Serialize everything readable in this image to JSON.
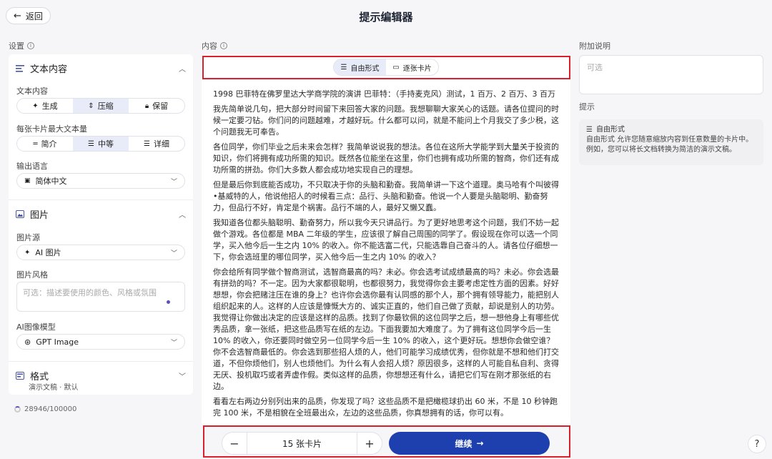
{
  "header": {
    "back_label": "返回",
    "title": "提示编辑器"
  },
  "settings": {
    "section_label": "设置",
    "text_group": {
      "title": "文本内容",
      "text_content_label": "文本内容",
      "text_content_options": [
        "生成",
        "压缩",
        "保留"
      ],
      "text_content_selected": "压缩",
      "max_text_label": "每张卡片最大文本量",
      "max_text_options": [
        "简介",
        "中等",
        "详细"
      ],
      "max_text_selected": "中等",
      "language_label": "输出语言",
      "language_value": "简体中文"
    },
    "image_group": {
      "title": "图片",
      "source_label": "图片源",
      "source_value": "AI 图片",
      "style_label": "图片风格",
      "style_placeholder": "可选：描述要使用的颜色、风格或氛围",
      "model_label": "AI图像模型",
      "model_value": "GPT Image"
    },
    "format_group": {
      "title": "格式",
      "subtitle": "演示文稿 · 默认"
    },
    "counter": "28946/100000"
  },
  "content": {
    "section_label": "内容",
    "modes": [
      "自由形式",
      "逐张卡片"
    ],
    "mode_selected": "自由形式",
    "paragraphs": [
      "1998 巴菲特在佛罗里达大学商学院的演讲 巴菲特：（手持麦克风）测试，1 百万、2 百万、3 百万",
      "我先简单说几句，把大部分时间留下来回答大家的问题。我想聊聊大家关心的话题。请各位提问的时候一定要刁钻。你们问的问题越难，才越好玩。什么都可以问，就是不能问上个月我交了多少税，这个问题我无可奉告。",
      "各位同学，你们毕业之后未来会怎样？我简单说说我的想法。各位在这所大学能学到大量关于投资的知识，你们将拥有成功所需的知识。既然各位能坐在这里，你们也拥有成功所需的智商，你们还有成功所需的拼劲。你们大多数人都会成功地实现自己的理想。",
      "但是最后你到底能否成功，不只取决于你的头脑和勤奋。我简单讲一下这个道理。奥马哈有个叫彼得•基威特的人，他说他招人的时候看三点：品行、头脑和勤奋。他说一个人要是头脑聪明、勤奋努力，但品行不好，肯定是个祸害。品行不端的人，最好又懒又蠢。",
      "我知道各位都头脑聪明、勤奋努力，所以我今天只讲品行。为了更好地思考这个问题，我们不妨一起做个游戏。各位都是 MBA 二年级的学生，应该很了解自己周围的同学了。假设现在你可以选一个同学，买入他今后一生之内 10% 的收入。你不能选富二代，只能选靠自己奋斗的人。请各位仔细想一下，你会选班里的哪位同学，买入他今后一生之内 10% 的收入？",
      "你会给所有同学做个智商测试，选智商最高的吗？未必。你会选考试成绩最高的吗？未必。你会选最有拼劲的吗？不一定。因为大家都很聪明，也都很努力，我觉得你会主要考虑定性方面的因素。好好想想，你会把赌注压在谁的身上？也许你会选你最有认同感的那个人，那个拥有领导能力，能把别人组织起来的人。这样的人应该是慷慨大方的、诚实正直的，他们自己做了贡献，却说是别人的功劳。我觉得让你做出决定的应该是这样的品质。找到了你最钦佩的这位同学之后，想一想他身上有哪些优秀品质，拿一张纸，把这些品质写在纸的左边。下面我要加大难度了。为了拥有这位同学今后一生 10% 的收入，你还要同时做空另一位同学今后一生 10% 的收入，这个更好玩。想想你会做空谁？你不会选智商最低的。你会选到那些招人烦的人，他们可能学习成绩优秀，但你就是不想和他们打交道，不但你烦他们，别人也烦他们。为什么有人会招人烦？原因很多，这样的人可能自私自利、贪得无厌、投机取巧或者弄虚作假。类似这样的品质，你想想还有什么，请把它们写在刚才那张纸的右边。",
      "看看左右两边分别列出来的品质，你发现了吗？这些品质不是把橄榄球扔出 60 米，不是 10 秒钟跑完 100 米，不是相貌在全班最出众，左边的这些品质，你真想拥有的话，你可以有。"
    ]
  },
  "footer": {
    "card_count": "15 张卡片",
    "minus": "−",
    "plus": "+",
    "continue_label": "继续",
    "continue_arrow": "→",
    "help": "?"
  },
  "notes": {
    "section_label": "附加说明",
    "placeholder": "可选",
    "tip_label": "提示",
    "tip_title": "自由形式",
    "tip_body": "自由形式 允许您随意缩放内容到任意数量的卡片中。例如，您可以将长文档转换为简洁的演示文稿。"
  },
  "colors": {
    "accent": "#1e3fae",
    "highlight_box": "#d9202c",
    "selected_bg": "#e8ecf9"
  },
  "icons": [
    "arrow-left-icon",
    "info-icon",
    "text-align-icon",
    "chevron-up-icon",
    "chevron-down-icon",
    "sparkle-icon",
    "compress-icon",
    "lock-icon",
    "list-icon",
    "flag-icon",
    "image-icon",
    "openai-icon",
    "layout-icon",
    "card-stack-icon",
    "spinner-icon",
    "arrow-right-icon"
  ]
}
